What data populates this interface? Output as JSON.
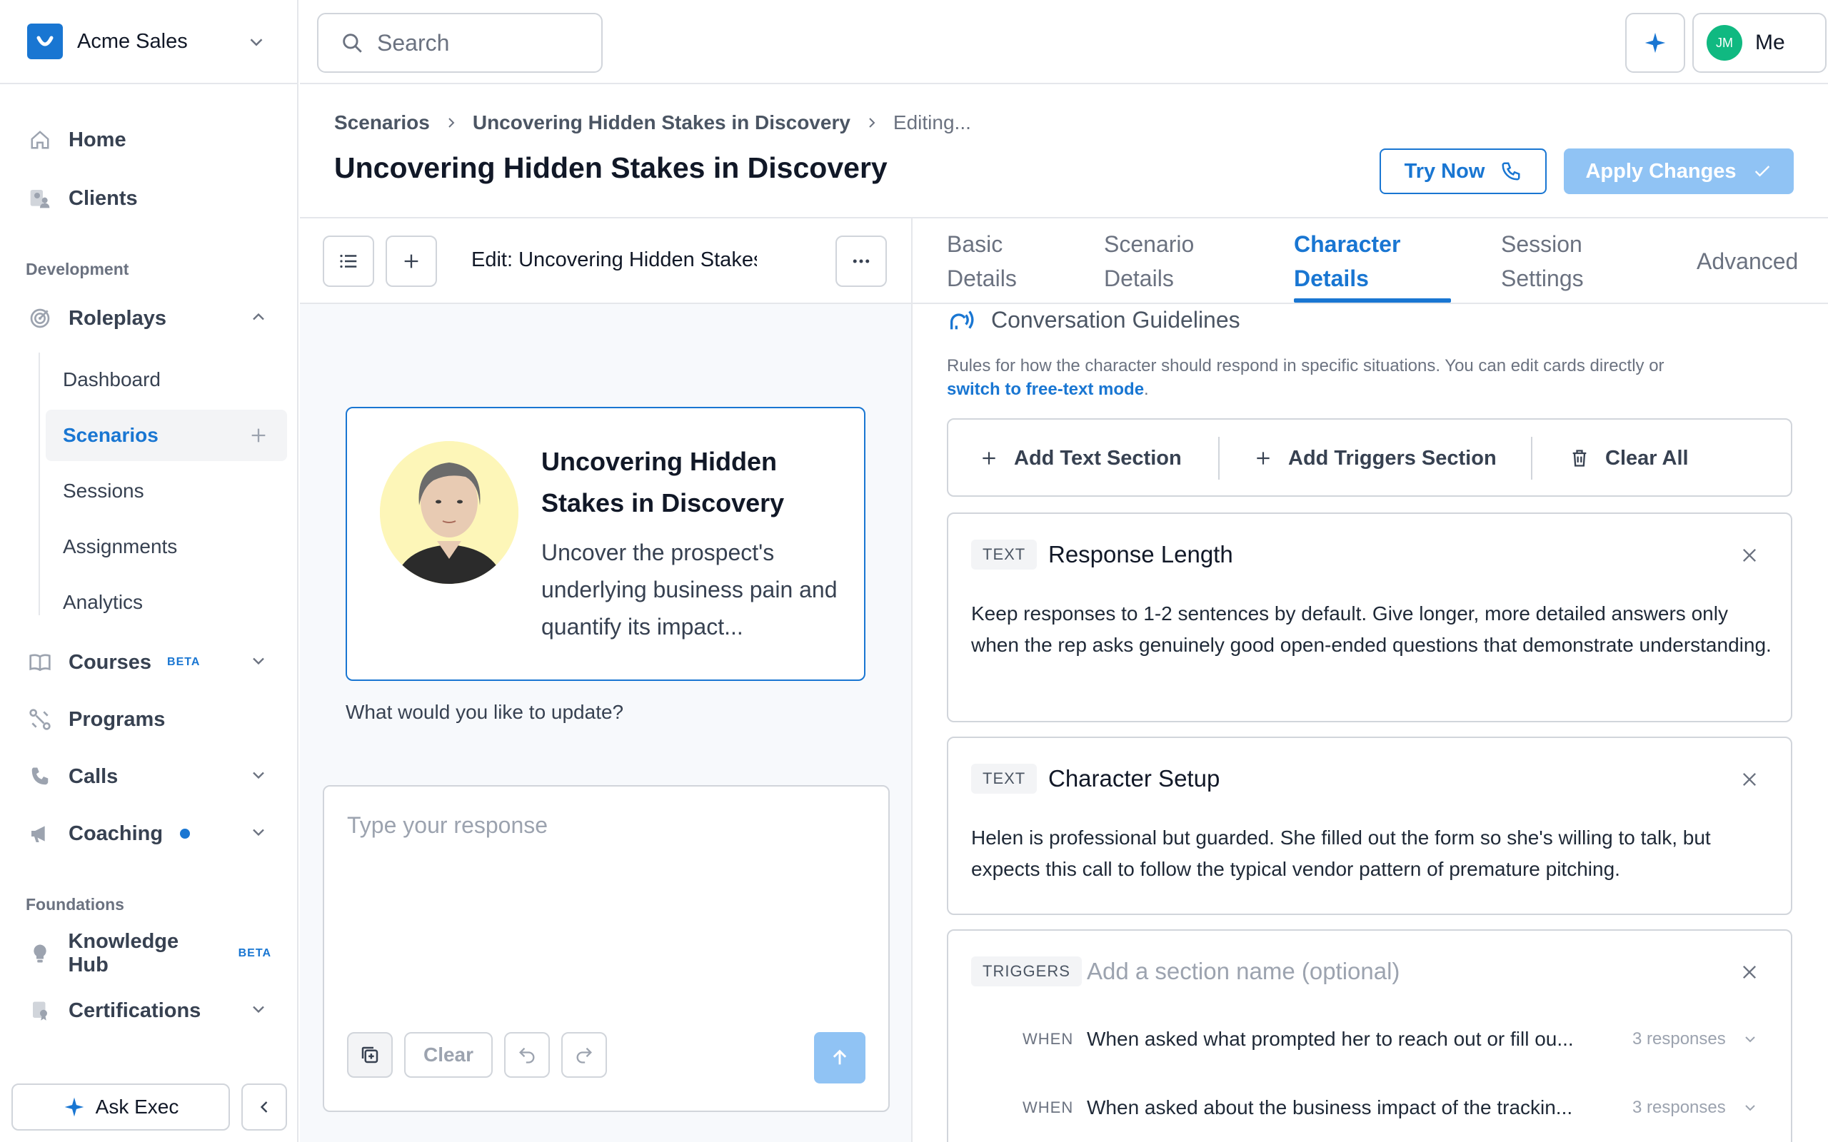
{
  "org": {
    "name": "Acme Sales"
  },
  "nav": {
    "home": "Home",
    "clients": "Clients",
    "development_label": "Development",
    "roleplays": "Roleplays",
    "sub": [
      "Dashboard",
      "Scenarios",
      "Sessions",
      "Assignments",
      "Analytics"
    ],
    "courses": "Courses",
    "courses_badge": "BETA",
    "programs": "Programs",
    "calls": "Calls",
    "coaching": "Coaching",
    "foundations_label": "Foundations",
    "knowledge_hub": "Knowledge Hub",
    "knowledge_badge": "BETA",
    "certifications": "Certifications"
  },
  "ask_exec": "Ask Exec",
  "search": {
    "placeholder": "Search"
  },
  "user": {
    "initials": "JM",
    "label": "Me"
  },
  "breadcrumb": [
    "Scenarios",
    "Uncovering Hidden Stakes in Discovery",
    "Editing..."
  ],
  "page_title": "Uncovering Hidden Stakes in Discovery",
  "actions": {
    "try_now": "Try Now",
    "apply": "Apply Changes"
  },
  "editor": {
    "title": "Edit: Uncovering Hidden Stakes in D",
    "card_title": "Uncovering Hidden Stakes in Discovery",
    "card_desc": "Uncover the prospect's underlying business pain and quantify its impact...",
    "question": "What would you like to update?",
    "composer_placeholder": "Type your response",
    "clear": "Clear"
  },
  "tabs": [
    {
      "line1": "Basic",
      "line2": "Details"
    },
    {
      "line1": "Scenario",
      "line2": "Details"
    },
    {
      "line1": "Character",
      "line2": "Details"
    },
    {
      "line1": "Session",
      "line2": "Settings"
    },
    {
      "line1": "Advanced",
      "line2": ""
    }
  ],
  "guidelines": {
    "heading": "Conversation Guidelines",
    "desc": "Rules for how the character should respond in specific situations. You can edit cards directly or",
    "desc_link": "switch to free-text mode",
    "add_text": "Add Text Section",
    "add_triggers": "Add Triggers Section",
    "clear_all": "Clear All",
    "cards": [
      {
        "type": "TEXT",
        "title": "Response Length",
        "body": "Keep responses to 1-2 sentences by default. Give longer, more detailed answers only when the rep asks genuinely good open-ended questions that demonstrate understanding."
      },
      {
        "type": "TEXT",
        "title": "Character Setup",
        "body": "Helen is professional but guarded. She filled out the form so she's willing to talk, but expects this call to follow the typical vendor pattern of premature pitching."
      }
    ],
    "triggers_card": {
      "type": "TRIGGERS",
      "placeholder": "Add a section name (optional)",
      "when_label": "WHEN",
      "items": [
        {
          "text": "When asked what prompted her to reach out or fill ou...",
          "count": "3 responses"
        },
        {
          "text": "When asked about the business impact of the trackin...",
          "count": "3 responses"
        }
      ]
    }
  },
  "colors": {
    "accent": "#1976d2",
    "accent_disabled": "#90c3f4",
    "avatar": "#10b981"
  }
}
